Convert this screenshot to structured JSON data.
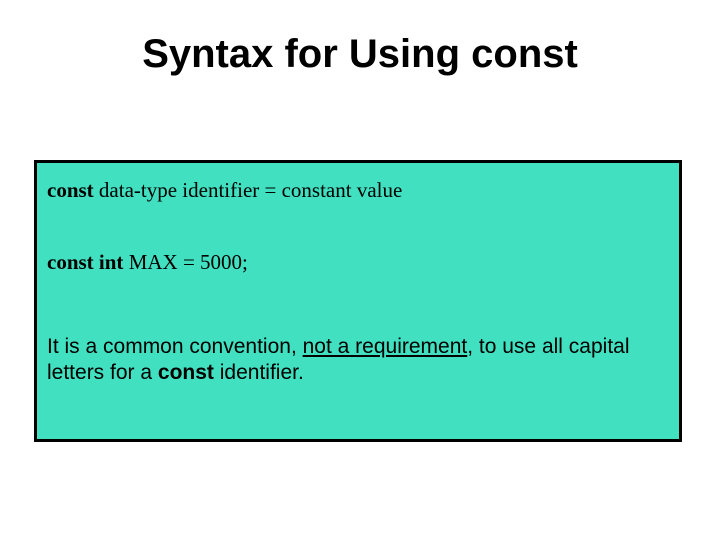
{
  "title": "Syntax for Using const",
  "box": {
    "syntax_line": {
      "kw": "const",
      "rest": " data-type identifier = constant value"
    },
    "example_line": {
      "kw": "const int",
      "rest": " MAX = 5000;"
    },
    "note": {
      "pre": "It is a common convention, ",
      "underlined": "not a requirement",
      "mid": ", to use all capital letters for a ",
      "kw": "const",
      "post": " identifier."
    }
  }
}
